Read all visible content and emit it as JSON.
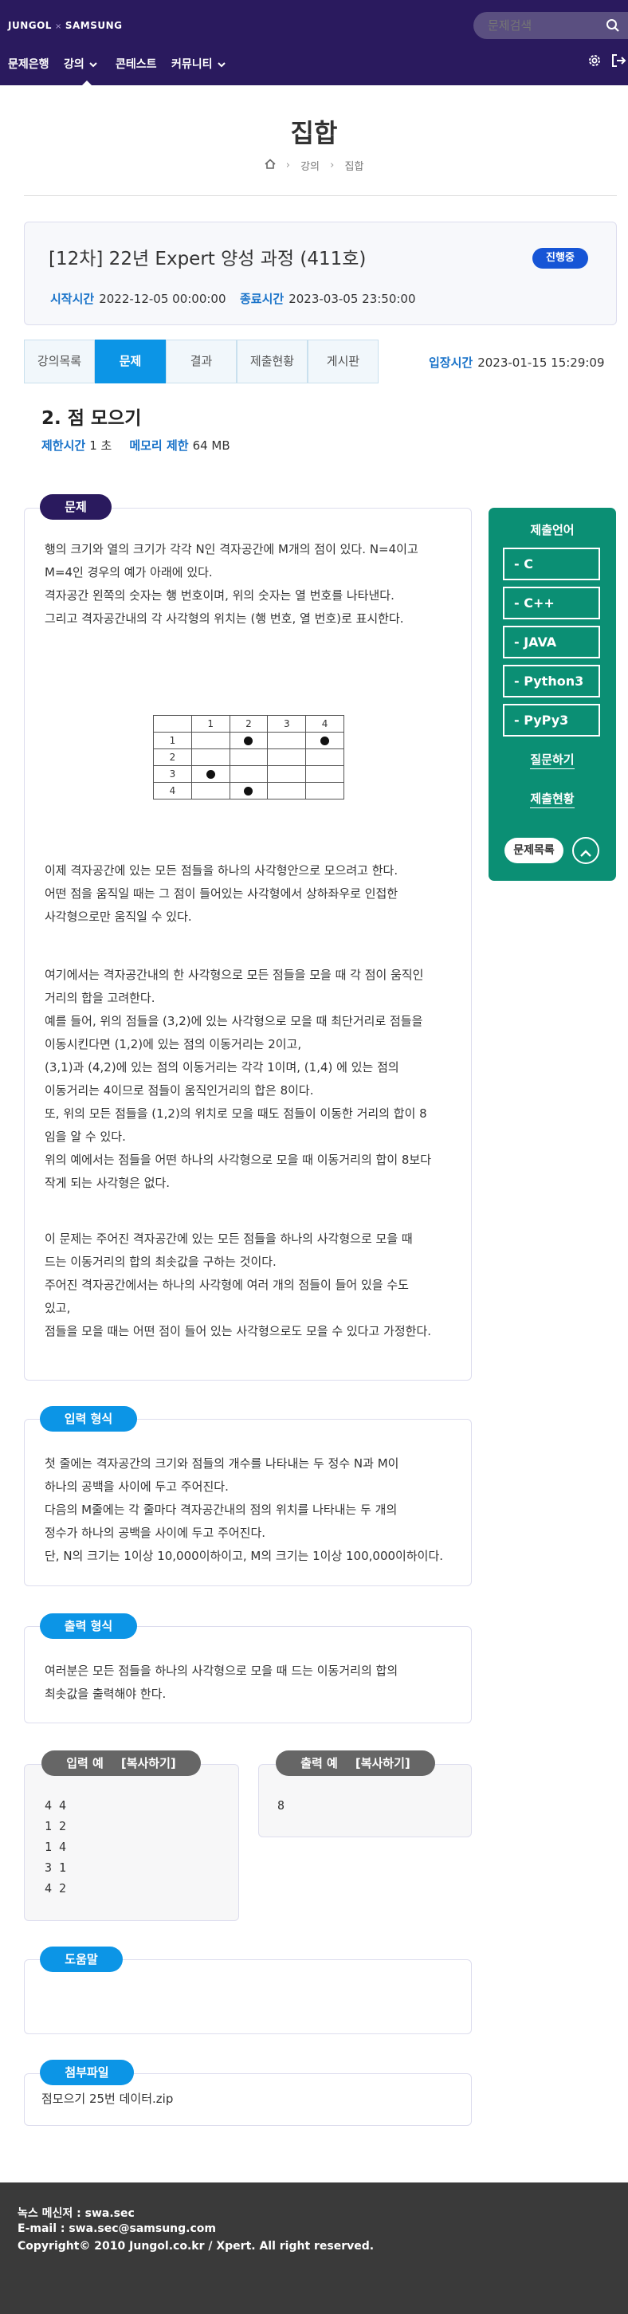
{
  "header": {
    "logo_left": "JUNGOL",
    "logo_sep": "×",
    "logo_right": "SAMSUNG",
    "search_placeholder": "문제검색",
    "nav": [
      "문제은행",
      "강의",
      "콘테스트",
      "커뮤니티"
    ]
  },
  "page": {
    "title": "집합",
    "breadcrumb": [
      "강의",
      "집합"
    ]
  },
  "course": {
    "title": "[12차] 22년 Expert 양성 과정 (411호)",
    "status": "진행중",
    "start_label": "시작시간",
    "start_value": "2022-12-05 00:00:00",
    "end_label": "종료시간",
    "end_value": "2023-03-05 23:50:00"
  },
  "tabs": [
    "강의목록",
    "문제",
    "결과",
    "제출현황",
    "게시판"
  ],
  "entry": {
    "label": "입장시간",
    "value": "2023-01-15 15:29:09"
  },
  "problem": {
    "title": "2. 점 모으기",
    "time_label": "제한시간",
    "time_value": "1 초",
    "memory_label": "메모리 제한",
    "memory_value": "64 MB",
    "section_label": "문제",
    "para1": [
      "행의 크기와 열의 크기가 각각 N인 격자공간에 M개의 점이 있다. N=4이고",
      "M=4인 경우의 예가 아래에 있다.",
      "격자공간 왼쪽의 숫자는 행 번호이며, 위의 숫자는 열 번호를 나타낸다.",
      "그리고 격자공간내의 각 사각형의 위치는 (행 번호, 열 번호)로 표시한다."
    ],
    "grid": {
      "header": [
        "",
        "1",
        "2",
        "3",
        "4"
      ],
      "rows": [
        "1",
        "2",
        "3",
        "4"
      ]
    },
    "para2": [
      "이제 격자공간에 있는 모든 점들을 하나의 사각형안으로 모으려고 한다.",
      "어떤 점을 움직일 때는 그 점이 들어있는 사각형에서 상하좌우로 인접한",
      "사각형으로만 움직일 수 있다."
    ],
    "para3": [
      "여기에서는 격자공간내의 한 사각형으로 모든 점들을 모을 때 각 점이 움직인",
      "거리의 합을 고려한다.",
      "예를 들어, 위의 점들을 (3,2)에 있는 사각형으로 모을 때 최단거리로 점들을",
      "이동시킨다면 (1,2)에 있는 점의 이동거리는 2이고,",
      "(3,1)과 (4,2)에 있는 점의 이동거리는 각각 1이며, (1,4) 에 있는 점의",
      "이동거리는 4이므로 점들이 움직인거리의 합은 8이다.",
      "또, 위의 모든 점들을 (1,2)의 위치로 모을 때도 점들이 이동한 거리의 합이 8",
      "임을 알 수 있다.",
      "위의 예에서는 점들을 어떤 하나의 사각형으로 모을 때 이동거리의 합이 8보다",
      "작게 되는 사각형은 없다."
    ],
    "para4": [
      "이 문제는 주어진 격자공간에 있는 모든 점들을 하나의 사각형으로 모을 때",
      "드는 이동거리의 합의 최솟값을 구하는 것이다.",
      "주어진 격자공간에서는 하나의 사각형에 여러 개의 점들이 들어 있을 수도",
      "있고,",
      "점들을 모을 때는 어떤 점이 들어 있는 사각형으로도 모을 수 있다고 가정한다."
    ]
  },
  "input_section": {
    "label": "입력 형식",
    "lines": [
      "첫 줄에는 격자공간의 크기와 점들의 개수를 나타내는 두 정수 N과 M이",
      "하나의 공백을 사이에 두고 주어진다.",
      "다음의 M줄에는 각 줄마다 격자공간내의 점의 위치를 나타내는 두 개의",
      "정수가 하나의 공백을 사이에 두고 주어진다.",
      "단, N의 크기는 1이상 10,000이하이고, M의 크기는 1이상 100,000이하이다."
    ]
  },
  "output_section": {
    "label": "출력 형식",
    "lines": [
      "여러분은 모든 점들을 하나의 사각형으로 모을 때 드는 이동거리의 합의",
      "최솟값을 출력해야 한다."
    ]
  },
  "samples": {
    "input_label": "입력 예",
    "output_label": "출력 예",
    "copy_label": "[복사하기]",
    "input_lines": [
      "4 4",
      "1 2",
      "1 4",
      "3 1",
      "4 2"
    ],
    "output_lines": [
      "8"
    ]
  },
  "help_section": {
    "label": "도움말"
  },
  "attach_section": {
    "label": "첨부파일",
    "file": "점모으기 25번 데이터.zip"
  },
  "sidebar": {
    "title": "제출언어",
    "languages": [
      "- C",
      "- C++",
      "- JAVA",
      "- Python3",
      "- PyPy3"
    ],
    "ask_link": "질문하기",
    "submit_status_link": "제출현황",
    "list_button": "문제목록"
  },
  "footer": {
    "line1": "녹스 메신저 : swa.sec",
    "line2": "E-mail : swa.sec@samsung.com",
    "line3": "Copyright© 2010 Jungol.co.kr / Xpert. All right reserved."
  },
  "colors": {
    "header_bg": "#2a1a5e",
    "accent_blue": "#0c95e6",
    "sidebar_green": "#0b8f74",
    "badge_blue": "#1655d6",
    "footer_bg": "#3a3a3a"
  }
}
